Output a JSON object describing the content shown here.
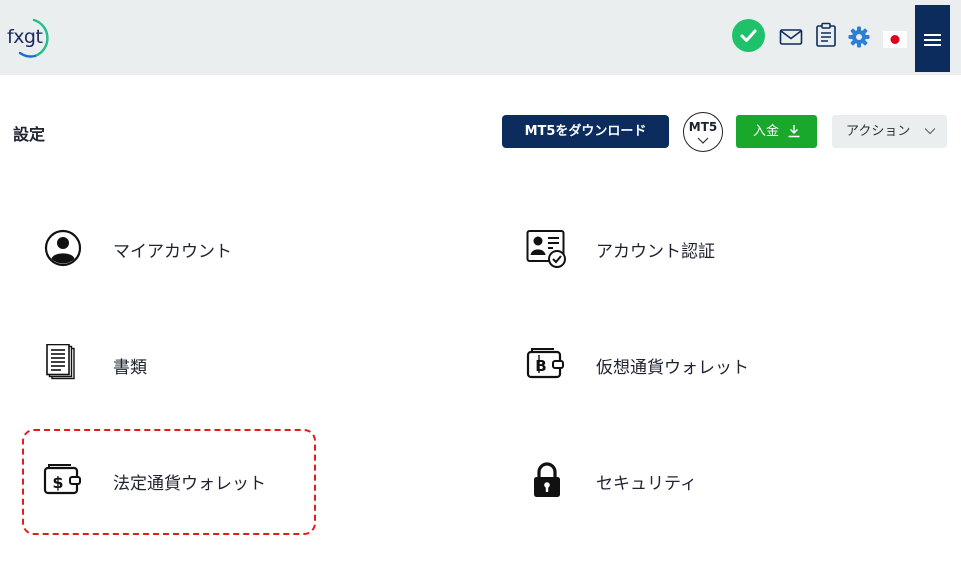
{
  "header": {
    "logo_text": "fxgt",
    "icons": [
      "status-check-icon",
      "mail-icon",
      "clipboard-icon",
      "gear-icon",
      "japan-flag-icon",
      "hamburger-menu-icon"
    ],
    "accent_color": "#0c2c5e",
    "status_color": "#1fc16b"
  },
  "title_row": {
    "page_title": "設定",
    "download_button": "MT5をダウンロード",
    "mt5_badge": "MT5",
    "deposit_button": "入金",
    "action_dropdown": "アクション"
  },
  "settings": {
    "items": [
      {
        "label": "マイアカウント",
        "icon": "user-icon"
      },
      {
        "label": "アカウント認証",
        "icon": "id-card-verify-icon"
      },
      {
        "label": "書類",
        "icon": "documents-icon"
      },
      {
        "label": "仮想通貨ウォレット",
        "icon": "crypto-wallet-icon"
      },
      {
        "label": "法定通貨ウォレット",
        "icon": "fiat-wallet-icon"
      },
      {
        "label": "セキュリティ",
        "icon": "lock-icon"
      }
    ],
    "highlight_color": "#e31b1b",
    "highlighted_item": "法定通貨ウォレット"
  }
}
